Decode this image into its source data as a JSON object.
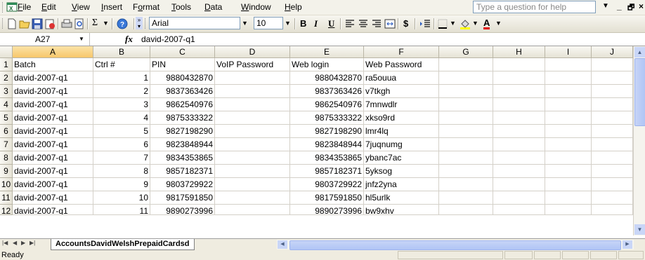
{
  "menubar": {
    "items": [
      {
        "pre": "",
        "u": "F",
        "post": "ile"
      },
      {
        "pre": "",
        "u": "E",
        "post": "dit"
      },
      {
        "pre": "",
        "u": "V",
        "post": "iew"
      },
      {
        "pre": "",
        "u": "I",
        "post": "nsert"
      },
      {
        "pre": "F",
        "u": "o",
        "post": "rmat"
      },
      {
        "pre": "",
        "u": "T",
        "post": "ools"
      },
      {
        "pre": "",
        "u": "D",
        "post": "ata"
      },
      {
        "pre": "",
        "u": "W",
        "post": "indow"
      },
      {
        "pre": "",
        "u": "H",
        "post": "elp"
      }
    ],
    "ask_placeholder": "Type a question for help"
  },
  "toolbar": {
    "font_name": "Arial",
    "font_size": "10",
    "sigma": "Σ",
    "bold": "B",
    "italic": "I",
    "underline": "U",
    "dollar": "$",
    "font_color_letter": "A"
  },
  "formula": {
    "namebox": "A27",
    "fx": "fx",
    "content": "david-2007-q1"
  },
  "columns": [
    "A",
    "B",
    "C",
    "D",
    "E",
    "F",
    "G",
    "H",
    "I",
    "J"
  ],
  "headers": [
    "Batch",
    "Ctrl #",
    "PIN",
    "VoIP Password",
    "Web login",
    "Web Password"
  ],
  "rows": [
    [
      "david-2007-q1",
      "1",
      "9880432870",
      "",
      "9880432870",
      "ra5ouua"
    ],
    [
      "david-2007-q1",
      "2",
      "9837363426",
      "",
      "9837363426",
      "v7tkgh"
    ],
    [
      "david-2007-q1",
      "3",
      "9862540976",
      "",
      "9862540976",
      "7mnwdlr"
    ],
    [
      "david-2007-q1",
      "4",
      "9875333322",
      "",
      "9875333322",
      "xkso9rd"
    ],
    [
      "david-2007-q1",
      "5",
      "9827198290",
      "",
      "9827198290",
      "lmr4lq"
    ],
    [
      "david-2007-q1",
      "6",
      "9823848944",
      "",
      "9823848944",
      "7juqnumg"
    ],
    [
      "david-2007-q1",
      "7",
      "9834353865",
      "",
      "9834353865",
      "ybanc7ac"
    ],
    [
      "david-2007-q1",
      "8",
      "9857182371",
      "",
      "9857182371",
      "5yksog"
    ],
    [
      "david-2007-q1",
      "9",
      "9803729922",
      "",
      "9803729922",
      "jnfz2yna"
    ],
    [
      "david-2007-q1",
      "10",
      "9817591850",
      "",
      "9817591850",
      "hl5urlk"
    ],
    [
      "david-2007-q1",
      "11",
      "9890273996",
      "",
      "9890273996",
      "bw9xhv"
    ]
  ],
  "row_numbers": [
    "1",
    "2",
    "3",
    "4",
    "5",
    "6",
    "7",
    "8",
    "9",
    "10",
    "11",
    "12"
  ],
  "sheet_tab": "AccountsDavidWelshPrepaidCardsd",
  "status": "Ready",
  "colors": {
    "selected_col": "#f7c76a",
    "accent": "#316ac5"
  }
}
